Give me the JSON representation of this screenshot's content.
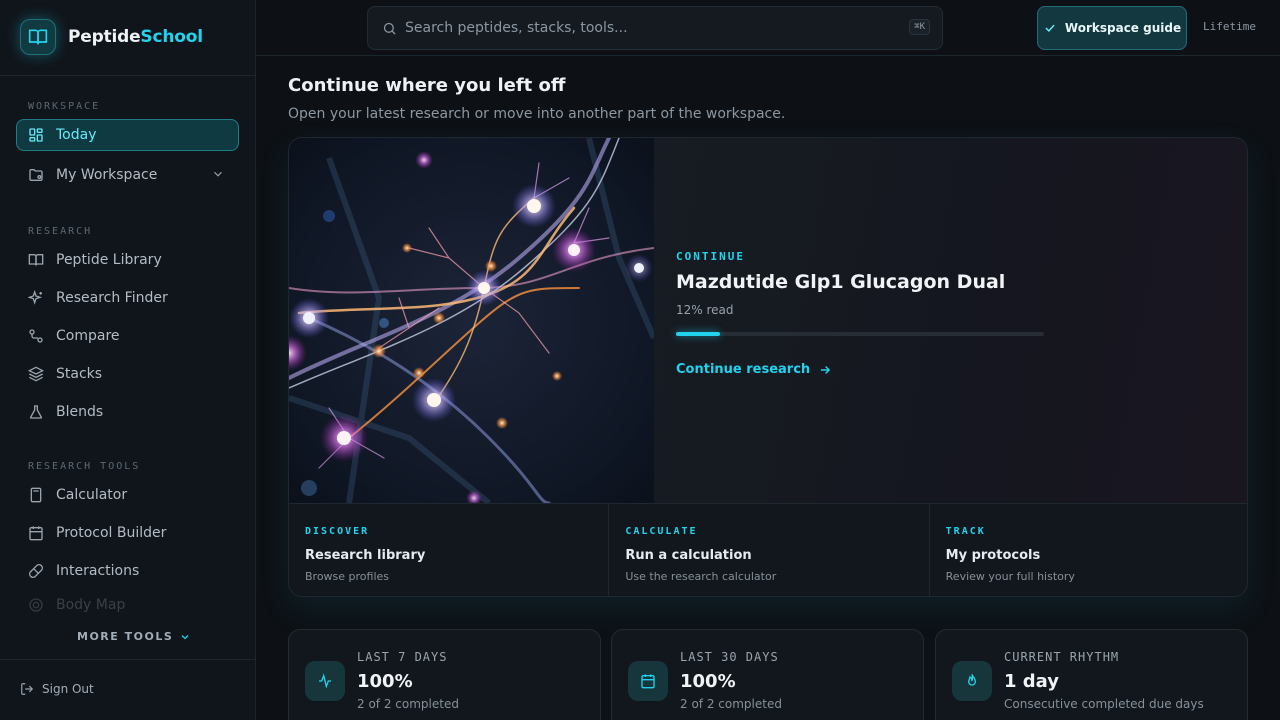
{
  "brand": {
    "name_part1": "Peptide",
    "name_part2": "School"
  },
  "sidebar": {
    "sections": [
      {
        "label": "WORKSPACE"
      },
      {
        "label": "RESEARCH"
      },
      {
        "label": "RESEARCH TOOLS"
      }
    ],
    "items": [
      {
        "label": "Today",
        "icon": "dashboard-icon",
        "active": true
      },
      {
        "label": "My Workspace",
        "icon": "folder-icon",
        "expandable": true
      },
      {
        "label": "Peptide Library",
        "icon": "book-open-icon"
      },
      {
        "label": "Research Finder",
        "icon": "sparkles-icon"
      },
      {
        "label": "Compare",
        "icon": "compare-icon"
      },
      {
        "label": "Stacks",
        "icon": "layers-icon"
      },
      {
        "label": "Blends",
        "icon": "flask-icon"
      },
      {
        "label": "Calculator",
        "icon": "calculator-icon"
      },
      {
        "label": "Protocol Builder",
        "icon": "calendar-icon"
      },
      {
        "label": "Interactions",
        "icon": "pill-icon"
      },
      {
        "label": "Body Map",
        "icon": "target-icon"
      }
    ],
    "more_tools_label": "MORE TOOLS",
    "sign_out_label": "Sign Out"
  },
  "topbar": {
    "search_placeholder": "Search peptides, stacks, tools...",
    "search_shortcut": "⌘K",
    "guide_button_label": "Workspace guide",
    "plan_label": "Lifetime"
  },
  "main": {
    "title": "Continue where you left off",
    "subtitle": "Open your latest research or move into another part of the workspace.",
    "hero": {
      "eyebrow": "CONTINUE",
      "title": "Mazdutide Glp1 Glucagon Dual",
      "read_label": "12% read",
      "progress_percent": 12,
      "cta_label": "Continue research"
    },
    "quick_links": [
      {
        "eyebrow": "DISCOVER",
        "title": "Research library",
        "subtitle": "Browse profiles"
      },
      {
        "eyebrow": "CALCULATE",
        "title": "Run a calculation",
        "subtitle": "Use the research calculator"
      },
      {
        "eyebrow": "TRACK",
        "title": "My protocols",
        "subtitle": "Review your full history"
      }
    ],
    "stats": [
      {
        "label": "LAST 7 DAYS",
        "value": "100%",
        "subtitle": "2 of 2 completed",
        "icon": "activity-icon"
      },
      {
        "label": "LAST 30 DAYS",
        "value": "100%",
        "subtitle": "2 of 2 completed",
        "icon": "calendar-icon"
      },
      {
        "label": "CURRENT RHYTHM",
        "value": "1 day",
        "subtitle": "Consecutive completed due days",
        "icon": "flame-icon"
      }
    ]
  },
  "colors": {
    "accent": "#22d3ee",
    "background": "#0d1116",
    "sidebar": "#10151b"
  }
}
